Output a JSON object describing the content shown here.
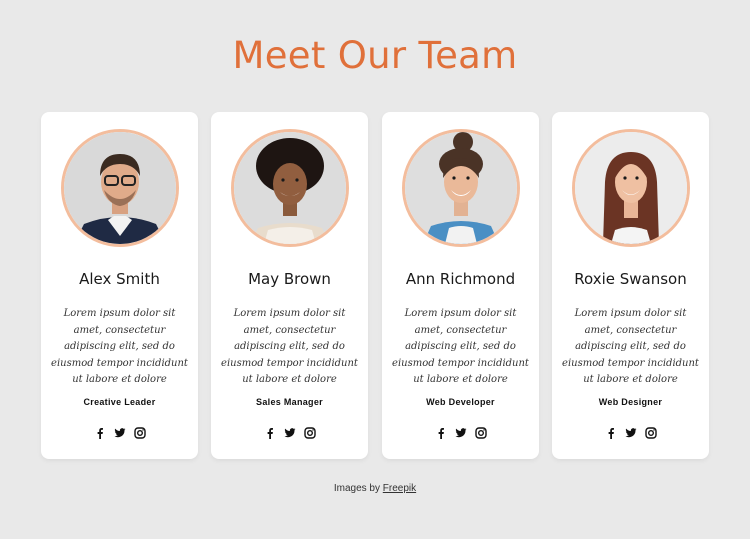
{
  "page": {
    "title": "Meet Our Team"
  },
  "team": [
    {
      "name": "Alex Smith",
      "bio": "Lorem ipsum dolor sit amet, consectetur adipiscing elit, sed do eiusmod tempor incididunt ut labore et dolore",
      "role": "Creative Leader"
    },
    {
      "name": "May Brown",
      "bio": "Lorem ipsum dolor sit amet, consectetur adipiscing elit, sed do eiusmod tempor incididunt ut labore et dolore",
      "role": "Sales Manager"
    },
    {
      "name": "Ann Richmond",
      "bio": "Lorem ipsum dolor sit amet, consectetur adipiscing elit, sed do eiusmod tempor incididunt ut labore et dolore",
      "role": "Web Developer"
    },
    {
      "name": "Roxie Swanson",
      "bio": "Lorem ipsum dolor sit amet, consectetur adipiscing elit, sed do eiusmod tempor incididunt ut labore et dolore",
      "role": "Web Designer"
    }
  ],
  "social_icons": [
    "facebook-icon",
    "twitter-icon",
    "instagram-icon"
  ],
  "credit": {
    "prefix": "Images by",
    "link": "Freepik"
  },
  "colors": {
    "accent": "#e0703a",
    "photo_ring": "#f3bd9d",
    "background": "#e9e9e9"
  }
}
